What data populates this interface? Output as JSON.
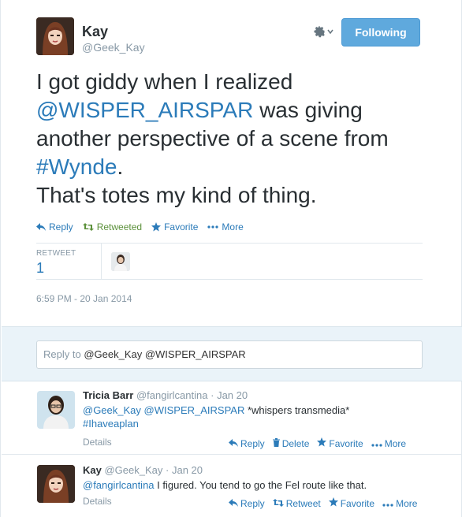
{
  "tweet": {
    "author_name": "Kay",
    "author_handle": "@Geek_Kay",
    "follow_label": "Following",
    "text_line1": "I got giddy when I realized",
    "mention": "@WISPER_AIRSPAR",
    "text_line2_rest": " was giving",
    "text_line3": "another perspective of a scene from",
    "hashtag": "#Wynde",
    "text_line4_rest": ".",
    "text_line5": "That's totes my kind of thing.",
    "actions": {
      "reply": "Reply",
      "retweeted": "Retweeted",
      "favorite": "Favorite",
      "more": "More"
    },
    "stats": {
      "label": "RETWEET",
      "value": "1"
    },
    "timestamp": "6:59 PM - 20 Jan 2014"
  },
  "reply_box": {
    "prefix": "Reply to",
    "mentions": " @Geek_Kay @WISPER_AIRSPAR"
  },
  "replies": [
    {
      "name": "Tricia Barr",
      "handle": "@fangirlcantina",
      "dot": "·",
      "time": "Jan 20",
      "mention1": "@Geek_Kay",
      "mention2": "@WISPER_AIRSPAR",
      "text_rest": " *whispers transmedia*",
      "hashtag": "#Ihaveaplan",
      "details": "Details",
      "actions": {
        "reply": "Reply",
        "delete": "Delete",
        "favorite": "Favorite",
        "more": "More"
      }
    },
    {
      "name": "Kay",
      "handle": "@Geek_Kay",
      "dot": "·",
      "time": "Jan 20",
      "mention1": "@fangirlcantina",
      "text_rest": " I figured. You tend to go the Fel route like that.",
      "details": "Details",
      "actions": {
        "reply": "Reply",
        "retweet": "Retweet",
        "favorite": "Favorite",
        "more": "More"
      }
    }
  ],
  "colors": {
    "accent": "#2b7bb9",
    "retweeted": "#5c913b",
    "follow_bg": "#5fa9dd",
    "reply_panel": "#eaf3f9"
  }
}
